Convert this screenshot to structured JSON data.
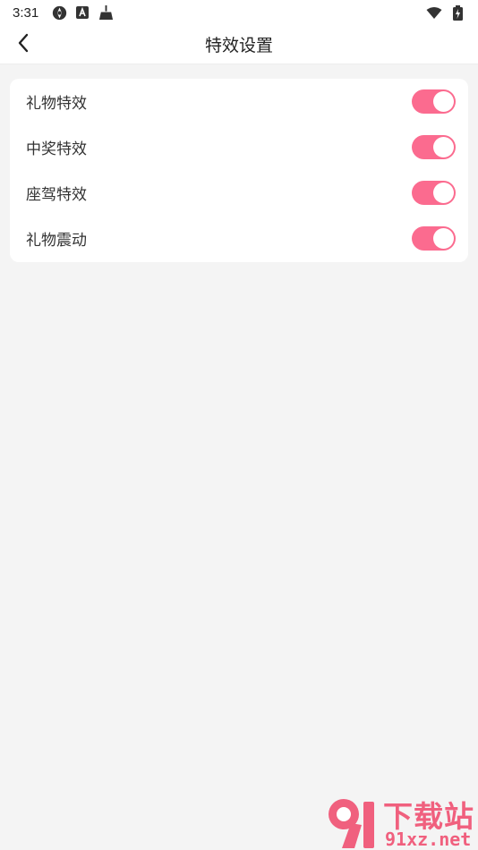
{
  "status_bar": {
    "time": "3:31",
    "left_icons": [
      "aperture-icon",
      "app-a-icon",
      "broom-icon"
    ],
    "right_icons": [
      "wifi-icon",
      "battery-charging-icon"
    ]
  },
  "header": {
    "title": "特效设置",
    "back_icon": "chevron-left-icon"
  },
  "settings": {
    "accent_color": "#fb6b8f",
    "items": [
      {
        "label": "礼物特效",
        "enabled": true
      },
      {
        "label": "中奖特效",
        "enabled": true
      },
      {
        "label": "座驾特效",
        "enabled": true
      },
      {
        "label": "礼物震动",
        "enabled": true
      }
    ]
  },
  "watermark": {
    "brand": "下载站",
    "url": "91xz.net",
    "color": "#f0607e"
  }
}
